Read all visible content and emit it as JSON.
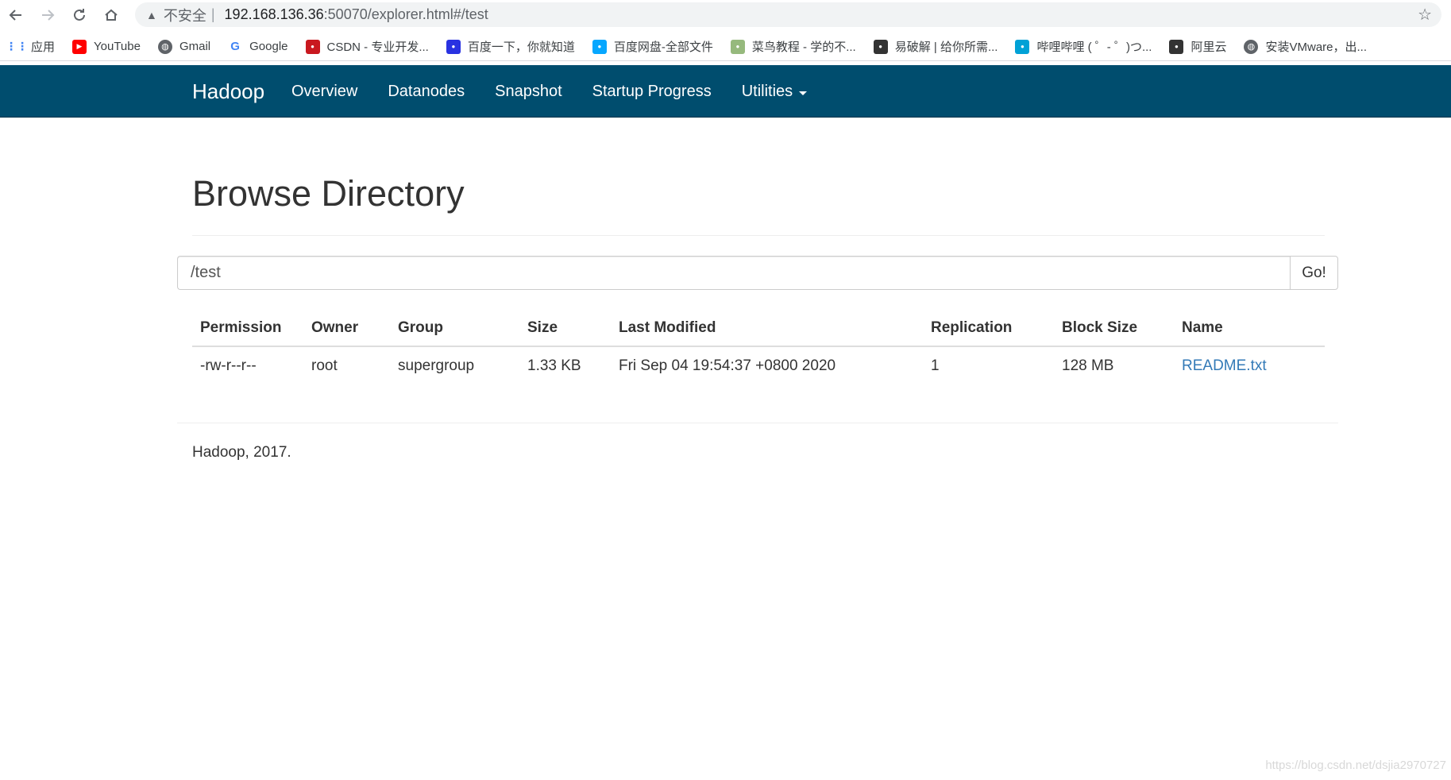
{
  "browser": {
    "url_insecure": "不安全",
    "url_separator": "|",
    "url_host": "192.168.136.36",
    "url_rest": ":50070/explorer.html#/test",
    "bookmarks": [
      {
        "label": "应用",
        "icon": "apps-grid-icon",
        "color": "#4285f4"
      },
      {
        "label": "YouTube",
        "icon": "youtube-icon",
        "color": "#ff0000"
      },
      {
        "label": "Gmail",
        "icon": "globe-icon",
        "color": "#5f6368"
      },
      {
        "label": "Google",
        "icon": "google-icon",
        "color": "#4285f4"
      },
      {
        "label": "CSDN - 专业开发...",
        "icon": "csdn-icon",
        "color": "#c9181f"
      },
      {
        "label": "百度一下，你就知道",
        "icon": "baidu-paw-icon",
        "color": "#2932e1"
      },
      {
        "label": "百度网盘-全部文件",
        "icon": "baidu-cloud-icon",
        "color": "#06a7ff"
      },
      {
        "label": "菜鸟教程 - 学的不...",
        "icon": "runoob-icon",
        "color": "#96b97d"
      },
      {
        "label": "易破解 | 给你所需...",
        "icon": "ypojie-icon",
        "color": "#333333"
      },
      {
        "label": "哔哩哔哩 ( ゜- ゜)つ...",
        "icon": "bilibili-icon",
        "color": "#00a1d6"
      },
      {
        "label": "阿里云",
        "icon": "aliyun-icon",
        "color": "#333333"
      },
      {
        "label": "安装VMware，出...",
        "icon": "globe-icon",
        "color": "#5f6368"
      }
    ]
  },
  "navbar": {
    "brand": "Hadoop",
    "items": [
      "Overview",
      "Datanodes",
      "Snapshot",
      "Startup Progress",
      "Utilities"
    ]
  },
  "page": {
    "title": "Browse Directory",
    "directory_value": "/test",
    "go_label": "Go!"
  },
  "table": {
    "headers": [
      "Permission",
      "Owner",
      "Group",
      "Size",
      "Last Modified",
      "Replication",
      "Block Size",
      "Name"
    ],
    "rows": [
      [
        "-rw-r--r--",
        "root",
        "supergroup",
        "1.33 KB",
        "Fri Sep 04 19:54:37 +0800 2020",
        "1",
        "128 MB",
        "README.txt"
      ]
    ]
  },
  "footer": "Hadoop, 2017.",
  "watermark": "https://blog.csdn.net/dsjia2970727",
  "colors": {
    "navbar": "#004d6e",
    "link": "#337ab7"
  }
}
